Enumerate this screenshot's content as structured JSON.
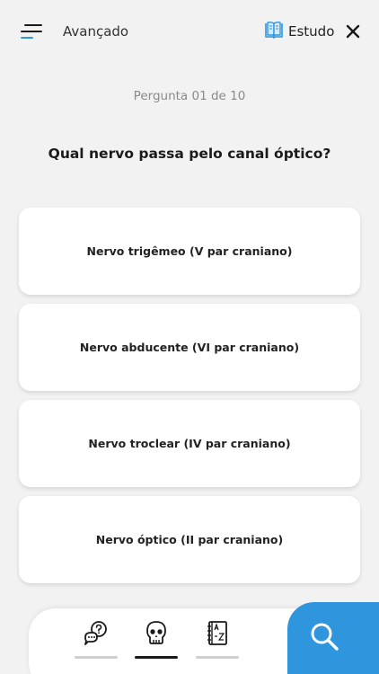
{
  "header": {
    "title": "Avançado",
    "study_label": "Estudo"
  },
  "quiz": {
    "counter": "Pergunta 01 de 10",
    "question": "Qual nervo passa pelo canal óptico?",
    "options": [
      "Nervo trigêmeo (V par craniano)",
      "Nervo abducente (VI par craniano)",
      "Nervo troclear (IV par craniano)",
      "Nervo óptico (II par craniano)"
    ]
  },
  "tabbar": {
    "tabs": [
      {
        "icon": "question-chat-icon",
        "active": false
      },
      {
        "icon": "skull-icon",
        "active": true
      },
      {
        "icon": "dictionary-az-icon",
        "active": false
      }
    ],
    "search_icon": "search-icon"
  },
  "colors": {
    "background": "#f2f2f2",
    "accent": "#2f95dc",
    "card": "#ffffff"
  }
}
